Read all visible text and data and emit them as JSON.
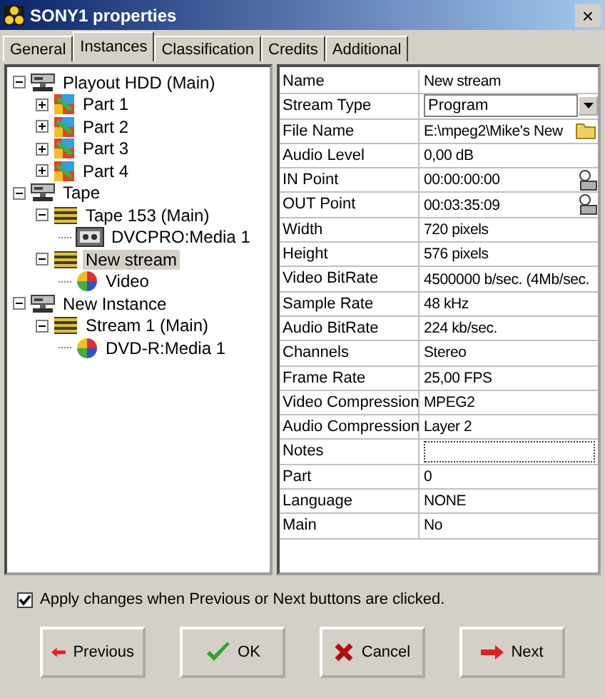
{
  "window": {
    "title": "SONY1 properties",
    "close": "×"
  },
  "tabs": [
    {
      "label": "General",
      "selected": false
    },
    {
      "label": "Instances",
      "selected": true
    },
    {
      "label": "Classification",
      "selected": false
    },
    {
      "label": "Credits",
      "selected": false
    },
    {
      "label": "Additional",
      "selected": false
    }
  ],
  "tree": [
    {
      "label": "Playout HDD (Main)",
      "kind": "drive",
      "expanded": true,
      "selected": false,
      "children": [
        {
          "label": "Part 1",
          "kind": "part",
          "expanded": false,
          "selected": false
        },
        {
          "label": "Part 2",
          "kind": "part",
          "expanded": false,
          "selected": false
        },
        {
          "label": "Part 3",
          "kind": "part",
          "expanded": false,
          "selected": false
        },
        {
          "label": "Part 4",
          "kind": "part",
          "expanded": false,
          "selected": false
        }
      ]
    },
    {
      "label": "Tape",
      "kind": "drive",
      "expanded": true,
      "selected": false,
      "children": [
        {
          "label": "Tape 153 (Main)",
          "kind": "stream",
          "expanded": true,
          "selected": false,
          "children": [
            {
              "label": "DVCPRO:Media 1",
              "kind": "media",
              "selected": false
            }
          ]
        },
        {
          "label": "New stream",
          "kind": "stream",
          "expanded": true,
          "selected": true,
          "children": [
            {
              "label": "Video",
              "kind": "video",
              "selected": false
            }
          ]
        }
      ]
    },
    {
      "label": "New Instance",
      "kind": "drive",
      "expanded": true,
      "selected": false,
      "children": [
        {
          "label": "Stream 1 (Main)",
          "kind": "stream",
          "expanded": true,
          "selected": false,
          "children": [
            {
              "label": "DVD-R:Media 1",
              "kind": "video",
              "selected": false
            }
          ]
        }
      ]
    }
  ],
  "properties": [
    {
      "name": "Name",
      "value": "New stream",
      "kind": "text"
    },
    {
      "name": "Stream Type",
      "value": "Program",
      "kind": "dropdown"
    },
    {
      "name": "File Name",
      "value": "E:\\mpeg2\\Mike's New",
      "kind": "file"
    },
    {
      "name": "Audio Level",
      "value": "0,00 dB",
      "kind": "text"
    },
    {
      "name": "IN Point",
      "value": "00:00:00:00",
      "kind": "time"
    },
    {
      "name": "OUT Point",
      "value": "00:03:35:09",
      "kind": "time"
    },
    {
      "name": "Width",
      "value": "720 pixels",
      "kind": "text"
    },
    {
      "name": "Height",
      "value": "576 pixels",
      "kind": "text"
    },
    {
      "name": "Video BitRate",
      "value": "4500000 b/sec. (4Mb/sec.",
      "kind": "text"
    },
    {
      "name": "Sample Rate",
      "value": "48 kHz",
      "kind": "text"
    },
    {
      "name": "Audio BitRate",
      "value": "224 kb/sec.",
      "kind": "text"
    },
    {
      "name": "Channels",
      "value": "Stereo",
      "kind": "text"
    },
    {
      "name": "Frame Rate",
      "value": "25,00 FPS",
      "kind": "text"
    },
    {
      "name": "Video Compression",
      "value": "MPEG2",
      "kind": "text"
    },
    {
      "name": "Audio Compression",
      "value": "Layer 2",
      "kind": "text"
    },
    {
      "name": "Notes",
      "kind": "focused"
    },
    {
      "name": "Part",
      "value": "0",
      "kind": "text"
    },
    {
      "name": "Language",
      "value": "NONE",
      "kind": "text"
    },
    {
      "name": "Main",
      "value": "No",
      "kind": "text"
    }
  ],
  "apply_option": {
    "label": "Apply changes when  Previous or Next buttons are clicked.",
    "checked": true
  },
  "buttons": [
    {
      "label": "Previous",
      "kind": "previous"
    },
    {
      "label": "OK",
      "kind": "ok"
    },
    {
      "label": "Cancel",
      "kind": "cancel"
    },
    {
      "label": "Next",
      "kind": "next"
    }
  ]
}
